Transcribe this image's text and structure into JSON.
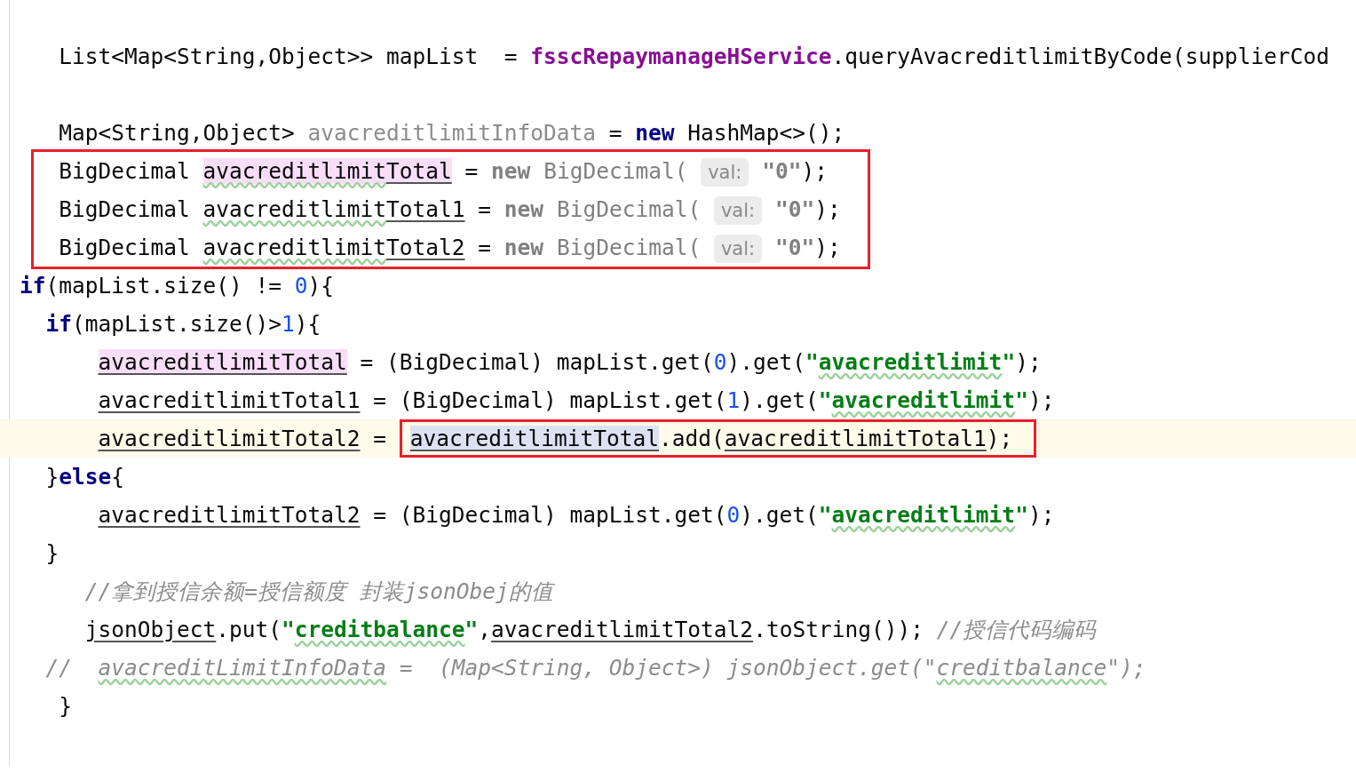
{
  "editor": {
    "blocks": [
      {
        "boxed": false,
        "lines": [
          {
            "current": false,
            "segments": [
              {
                "boxed": false,
                "tokens": [
                  {
                    "text": "   List<Map<String,Object>> mapList  = ",
                    "kind": "plain"
                  },
                  {
                    "text": "fsscRepaymanageHService",
                    "kind": "field"
                  },
                  {
                    "text": ".queryAvacreditlimitByCode(supplierCod",
                    "kind": "plain"
                  }
                ]
              }
            ]
          },
          {
            "current": false
          },
          {
            "current": false,
            "segments": [
              {
                "boxed": false,
                "tokens": [
                  {
                    "text": "   Map<String,Object> ",
                    "kind": "plain"
                  },
                  {
                    "text": "avacreditlimitInfoData",
                    "kind": "unused"
                  },
                  {
                    "text": " = ",
                    "kind": "plain"
                  },
                  {
                    "text": "new",
                    "kind": "keyword"
                  },
                  {
                    "text": " HashMap<>();",
                    "kind": "plain"
                  }
                ]
              }
            ]
          }
        ]
      },
      {
        "boxed": true,
        "lines": [
          {
            "current": false,
            "segments": [
              {
                "boxed": false,
                "tokens": [
                  {
                    "text": "   BigDecimal ",
                    "kind": "plain"
                  },
                  {
                    "text": "avacreditlimit",
                    "kind": "write-usage",
                    "misspelled": true
                  },
                  {
                    "text": "Total",
                    "kind": "write-usage",
                    "underlined": true
                  },
                  {
                    "text": " = ",
                    "kind": "plain"
                  },
                  {
                    "text": "new",
                    "kind": "redundant-keyword"
                  },
                  {
                    "text": " BigDecimal( ",
                    "kind": "redundant"
                  },
                  {
                    "text": "val:",
                    "kind": "hint"
                  },
                  {
                    "text": " \"0\"",
                    "kind": "redundant-string"
                  },
                  {
                    "text": ");",
                    "kind": "plain"
                  }
                ]
              }
            ]
          },
          {
            "current": false,
            "segments": [
              {
                "boxed": false,
                "tokens": [
                  {
                    "text": "   BigDecimal ",
                    "kind": "plain"
                  },
                  {
                    "text": "avacreditlimit",
                    "kind": "plain",
                    "misspelled": true
                  },
                  {
                    "text": "Total1",
                    "kind": "plain",
                    "underlined": true
                  },
                  {
                    "text": " = ",
                    "kind": "plain"
                  },
                  {
                    "text": "new",
                    "kind": "redundant-keyword"
                  },
                  {
                    "text": " BigDecimal( ",
                    "kind": "redundant"
                  },
                  {
                    "text": "val:",
                    "kind": "hint"
                  },
                  {
                    "text": " \"0\"",
                    "kind": "redundant-string"
                  },
                  {
                    "text": ");",
                    "kind": "plain"
                  }
                ]
              }
            ]
          },
          {
            "current": false,
            "segments": [
              {
                "boxed": false,
                "tokens": [
                  {
                    "text": "   BigDecimal ",
                    "kind": "plain"
                  },
                  {
                    "text": "avacreditlimit",
                    "kind": "plain",
                    "misspelled": true
                  },
                  {
                    "text": "Total2",
                    "kind": "plain",
                    "underlined": true
                  },
                  {
                    "text": " = ",
                    "kind": "plain"
                  },
                  {
                    "text": "new",
                    "kind": "redundant-keyword"
                  },
                  {
                    "text": " BigDecimal( ",
                    "kind": "redundant"
                  },
                  {
                    "text": "val:",
                    "kind": "hint"
                  },
                  {
                    "text": " \"0\"",
                    "kind": "redundant-string"
                  },
                  {
                    "text": ");",
                    "kind": "plain"
                  }
                ]
              }
            ]
          }
        ]
      },
      {
        "boxed": false,
        "lines": [
          {
            "current": false,
            "segments": [
              {
                "boxed": false,
                "tokens": [
                  {
                    "text": "if",
                    "kind": "keyword"
                  },
                  {
                    "text": "(mapList.size() != ",
                    "kind": "plain"
                  },
                  {
                    "text": "0",
                    "kind": "number"
                  },
                  {
                    "text": "){",
                    "kind": "plain"
                  }
                ]
              }
            ]
          },
          {
            "current": false,
            "segments": [
              {
                "boxed": false,
                "tokens": [
                  {
                    "text": "  if",
                    "kind": "keyword"
                  },
                  {
                    "text": "(mapList.size()>",
                    "kind": "plain"
                  },
                  {
                    "text": "1",
                    "kind": "number"
                  },
                  {
                    "text": "){",
                    "kind": "plain"
                  }
                ]
              }
            ]
          },
          {
            "current": false,
            "segments": [
              {
                "boxed": false,
                "tokens": [
                  {
                    "text": "      avacreditlimitTotal",
                    "kind": "write-usage",
                    "underlined": true
                  },
                  {
                    "text": " = (BigDecimal) mapList.get(",
                    "kind": "plain"
                  },
                  {
                    "text": "0",
                    "kind": "number"
                  },
                  {
                    "text": ").get(",
                    "kind": "plain"
                  },
                  {
                    "text": "\"",
                    "kind": "string"
                  },
                  {
                    "text": "avacreditlimit",
                    "kind": "string",
                    "misspelled": true
                  },
                  {
                    "text": "\"",
                    "kind": "string"
                  },
                  {
                    "text": ");",
                    "kind": "plain"
                  }
                ]
              }
            ]
          },
          {
            "current": false,
            "segments": [
              {
                "boxed": false,
                "tokens": [
                  {
                    "text": "      avacreditlimitTotal1",
                    "kind": "plain",
                    "underlined": true
                  },
                  {
                    "text": " = (BigDecimal) mapList.get(",
                    "kind": "plain"
                  },
                  {
                    "text": "1",
                    "kind": "number"
                  },
                  {
                    "text": ").get(",
                    "kind": "plain"
                  },
                  {
                    "text": "\"",
                    "kind": "string"
                  },
                  {
                    "text": "avacreditlimit",
                    "kind": "string",
                    "misspelled": true
                  },
                  {
                    "text": "\"",
                    "kind": "string"
                  },
                  {
                    "text": ");",
                    "kind": "plain"
                  }
                ]
              }
            ]
          },
          {
            "current": true,
            "segments": [
              {
                "boxed": false,
                "tokens": [
                  {
                    "text": "      avacreditlimitTotal2",
                    "kind": "plain",
                    "underlined": true
                  },
                  {
                    "text": " = ",
                    "kind": "plain"
                  }
                ]
              },
              {
                "boxed": true,
                "tokens": [
                  {
                    "text": "avacreditlimitTotal",
                    "kind": "read-usage",
                    "underlined": true
                  },
                  {
                    "text": ".add(",
                    "kind": "plain"
                  },
                  {
                    "text": "avacreditlimitTotal1",
                    "kind": "plain",
                    "underlined": true
                  },
                  {
                    "text": ");",
                    "kind": "plain"
                  }
                ]
              }
            ]
          },
          {
            "current": false,
            "segments": [
              {
                "boxed": false,
                "tokens": [
                  {
                    "text": "  }",
                    "kind": "plain"
                  },
                  {
                    "text": "else",
                    "kind": "keyword"
                  },
                  {
                    "text": "{",
                    "kind": "plain"
                  }
                ]
              }
            ]
          },
          {
            "current": false,
            "segments": [
              {
                "boxed": false,
                "tokens": [
                  {
                    "text": "      avacreditlimitTotal2",
                    "kind": "plain",
                    "underlined": true
                  },
                  {
                    "text": " = (BigDecimal) mapList.get(",
                    "kind": "plain"
                  },
                  {
                    "text": "0",
                    "kind": "number"
                  },
                  {
                    "text": ").get(",
                    "kind": "plain"
                  },
                  {
                    "text": "\"",
                    "kind": "string"
                  },
                  {
                    "text": "avacreditlimit",
                    "kind": "string",
                    "misspelled": true
                  },
                  {
                    "text": "\"",
                    "kind": "string"
                  },
                  {
                    "text": ");",
                    "kind": "plain"
                  }
                ]
              }
            ]
          },
          {
            "current": false,
            "segments": [
              {
                "boxed": false,
                "tokens": [
                  {
                    "text": "  }",
                    "kind": "plain"
                  }
                ]
              }
            ]
          },
          {
            "current": false,
            "segments": [
              {
                "boxed": false,
                "tokens": [
                  {
                    "text": "     //拿到授信余额=授信额度 封装jsonObej的值",
                    "kind": "comment"
                  }
                ]
              }
            ]
          },
          {
            "current": false,
            "segments": [
              {
                "boxed": false,
                "tokens": [
                  {
                    "text": "     jsonObject",
                    "kind": "plain",
                    "underlined": true
                  },
                  {
                    "text": ".put(",
                    "kind": "plain"
                  },
                  {
                    "text": "\"",
                    "kind": "string"
                  },
                  {
                    "text": "creditbalance",
                    "kind": "string",
                    "misspelled": true
                  },
                  {
                    "text": "\"",
                    "kind": "string"
                  },
                  {
                    "text": ",",
                    "kind": "plain"
                  },
                  {
                    "text": "avacreditlimitTotal2",
                    "kind": "plain",
                    "underlined": true
                  },
                  {
                    "text": ".toString()); ",
                    "kind": "plain"
                  },
                  {
                    "text": "//授信代码编码",
                    "kind": "comment"
                  }
                ]
              }
            ]
          },
          {
            "current": false,
            "segments": [
              {
                "boxed": false,
                "tokens": [
                  {
                    "text": "  //  ",
                    "kind": "comment"
                  },
                  {
                    "text": "avacreditLimitInfoData",
                    "kind": "comment",
                    "misspelled": true
                  },
                  {
                    "text": " =  (Map<String, Object>) jsonObject.get(\"",
                    "kind": "comment"
                  },
                  {
                    "text": "creditbalance",
                    "kind": "comment",
                    "misspelled": true
                  },
                  {
                    "text": "\");",
                    "kind": "comment"
                  }
                ]
              }
            ]
          },
          {
            "current": false,
            "segments": [
              {
                "boxed": false,
                "tokens": [
                  {
                    "text": "   }",
                    "kind": "plain"
                  }
                ]
              }
            ]
          }
        ]
      }
    ]
  }
}
